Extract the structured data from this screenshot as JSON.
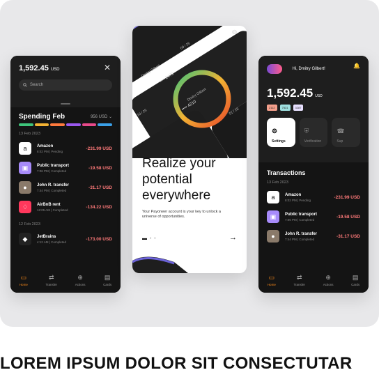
{
  "phone1": {
    "balance": "1,592.45",
    "currency": "USD",
    "search_placeholder": "Search",
    "spending_title": "Spending Feb",
    "spending_amount": "956 USD",
    "spending_bar_colors": [
      "#3ec47a",
      "#f2b233",
      "#ff7a3d",
      "#9b59f0",
      "#e84a8a",
      "#3aa0e8"
    ],
    "groups": [
      {
        "date": "13 Feb 2023",
        "items": [
          {
            "name": "Amazon",
            "meta": "8:02 PM | Pending",
            "amount": "-231.99 USD",
            "icon": "amazon-icon",
            "icon_bg": "#ffffff",
            "glyph": "a"
          },
          {
            "name": "Public transport",
            "meta": "7:06 PM | Completed",
            "amount": "-19.58 USD",
            "icon": "bus-icon",
            "icon_bg": "#a78bfa",
            "glyph": "▣"
          },
          {
            "name": "John R. transfer",
            "meta": "7:44 PM | Completed",
            "amount": "-31.17 USD",
            "icon": "avatar-icon",
            "icon_bg": "#8a7a6a",
            "glyph": "●"
          },
          {
            "name": "AirBnB rent",
            "meta": "12:05 AM | Completed",
            "amount": "-134.22 USD",
            "icon": "airbnb-icon",
            "icon_bg": "#ff385c",
            "glyph": "♢"
          }
        ]
      },
      {
        "date": "12 Feb 2023",
        "items": [
          {
            "name": "JetBrains",
            "meta": "4:12 AM | Completed",
            "amount": "-173.00 USD",
            "icon": "jetbrains-icon",
            "icon_bg": "#222222",
            "glyph": "◆"
          }
        ]
      }
    ]
  },
  "nav": [
    {
      "label": "Home",
      "icon": "home-icon",
      "glyph": "▭",
      "active": true
    },
    {
      "label": "Transfer",
      "icon": "transfer-icon",
      "glyph": "⇄",
      "active": false
    },
    {
      "label": "Actions",
      "icon": "actions-icon",
      "glyph": "⊕",
      "active": false
    },
    {
      "label": "Cards",
      "icon": "cards-icon",
      "glyph": "▤",
      "active": false
    }
  ],
  "phone2": {
    "cards": [
      {
        "label": "Dmitry Gilbert",
        "number": "•••• 2479",
        "expiry": "09 / 25"
      },
      {
        "label": "Dmitry Gilbert",
        "number": "•••• 4210",
        "expiry": "01 / 28"
      },
      {
        "label": "",
        "number": "",
        "expiry": "10 / 25"
      }
    ],
    "headline": "Realize your potential everywhere",
    "subtext": "Your Payoneer account is your key to unlock a universe of opportunities."
  },
  "phone3": {
    "greeting": "Hi, Dmitry Gilbert!",
    "balance": "1,592.45",
    "currency": "USD",
    "chips": [
      {
        "text": "2112",
        "color": "#f5a08c"
      },
      {
        "text": "7531",
        "color": "#9fe0e0"
      },
      {
        "text": "3287",
        "color": "#e8e0ff"
      }
    ],
    "tiles": [
      {
        "label": "Settings",
        "icon": "sliders-icon",
        "glyph": "⚙",
        "active": true
      },
      {
        "label": "Verification",
        "icon": "shield-icon",
        "glyph": "⛨",
        "active": false
      },
      {
        "label": "Sup",
        "icon": "support-icon",
        "glyph": "☎",
        "active": false
      }
    ],
    "transactions_title": "Transactions",
    "date": "13 Feb 2023",
    "items": [
      {
        "name": "Amazon",
        "meta": "8:02 PM | Pending",
        "amount": "-231.99 USD",
        "icon": "amazon-icon",
        "icon_bg": "#ffffff",
        "glyph": "a"
      },
      {
        "name": "Public transport",
        "meta": "7:06 PM | Completed",
        "amount": "-19.58 USD",
        "icon": "bus-icon",
        "icon_bg": "#a78bfa",
        "glyph": "▣"
      },
      {
        "name": "John R. transfer",
        "meta": "7:44 PM | Completed",
        "amount": "-31.17 USD",
        "icon": "avatar-icon",
        "icon_bg": "#8a7a6a",
        "glyph": "●"
      }
    ]
  },
  "caption": "LOREM IPSUM DOLOR SIT CONSECTUTAR"
}
